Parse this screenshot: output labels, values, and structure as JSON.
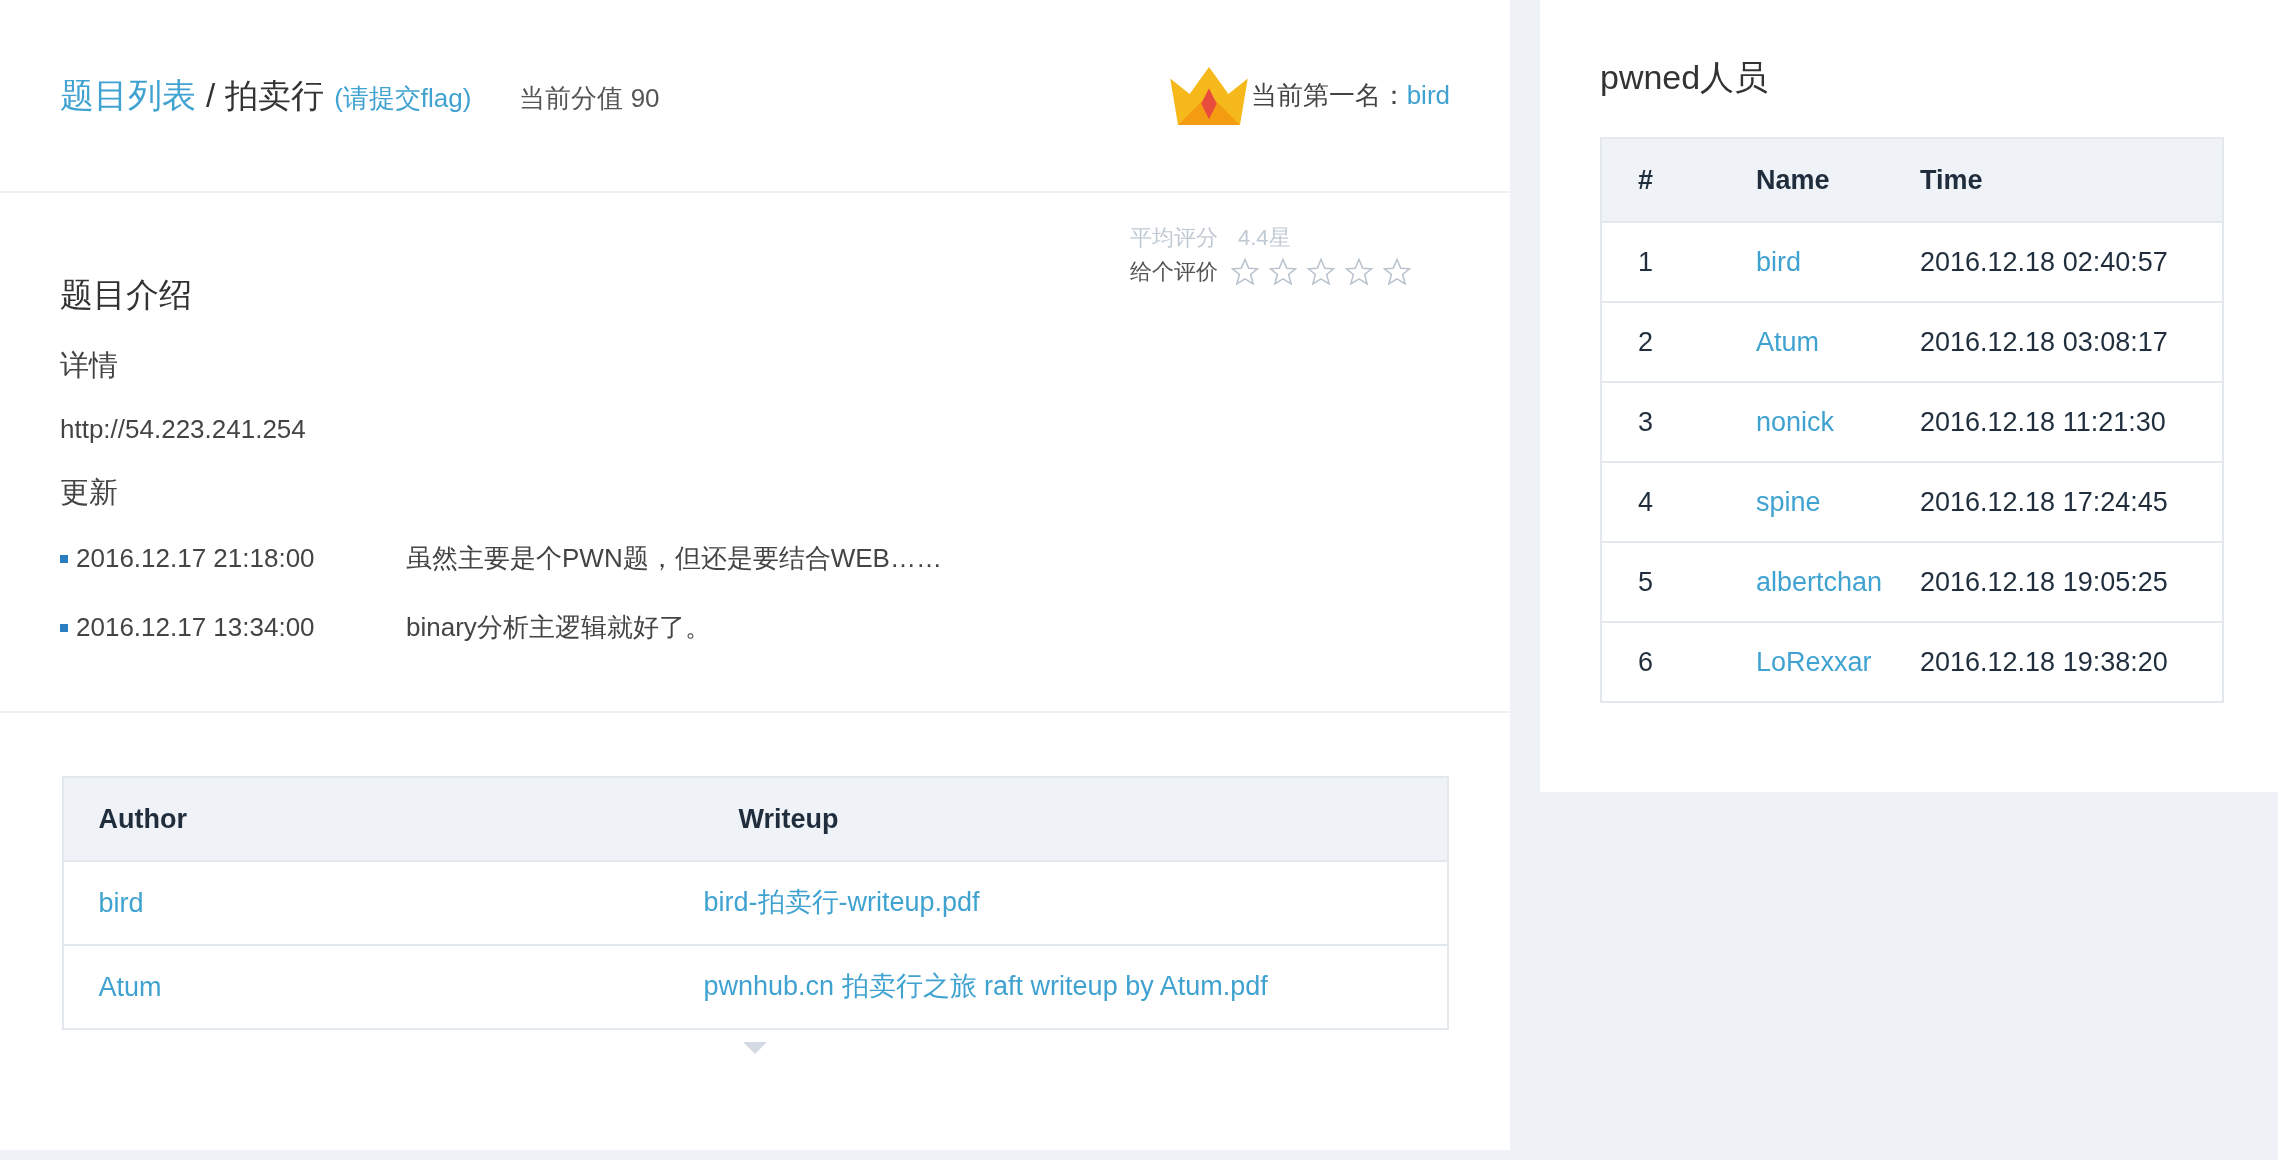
{
  "header": {
    "breadcrumb_link": "题目列表",
    "separator": "/",
    "title": "拍卖行",
    "flag_link": "(请提交flag)",
    "score": "当前分值 90",
    "leader_label": "当前第一名：",
    "leader_name": "bird"
  },
  "intro": {
    "heading": "题目介绍",
    "rating": {
      "average_label": "平均评分",
      "average_value": "4.4星",
      "rate_label": "给个评价",
      "stars": 0
    },
    "details_heading": "详情",
    "details_text": "http://54.223.241.254",
    "updates_heading": "更新",
    "updates": [
      {
        "time": "2016.12.17 21:18:00",
        "text": "虽然主要是个PWN题，但还是要结合WEB……"
      },
      {
        "time": "2016.12.17 13:34:00",
        "text": "binary分析主逻辑就好了。"
      }
    ]
  },
  "writeups": {
    "columns": [
      "Author",
      "Writeup"
    ],
    "rows": [
      {
        "author": "bird",
        "writeup": "bird-拍卖行-writeup.pdf"
      },
      {
        "author": "Atum",
        "writeup": "pwnhub.cn 拍卖行之旅 raft writeup by Atum.pdf"
      }
    ]
  },
  "pwned": {
    "title": "pwned人员",
    "columns": [
      "#",
      "Name",
      "Time"
    ],
    "rows": [
      {
        "rank": "1",
        "name": "bird",
        "time": "2016.12.18 02:40:57"
      },
      {
        "rank": "2",
        "name": "Atum",
        "time": "2016.12.18 03:08:17"
      },
      {
        "rank": "3",
        "name": "nonick",
        "time": "2016.12.18 11:21:30"
      },
      {
        "rank": "4",
        "name": "spine",
        "time": "2016.12.18 17:24:45"
      },
      {
        "rank": "5",
        "name": "albertchan",
        "time": "2016.12.18 19:05:25"
      },
      {
        "rank": "6",
        "name": "LoRexxar",
        "time": "2016.12.18 19:38:20"
      }
    ]
  }
}
